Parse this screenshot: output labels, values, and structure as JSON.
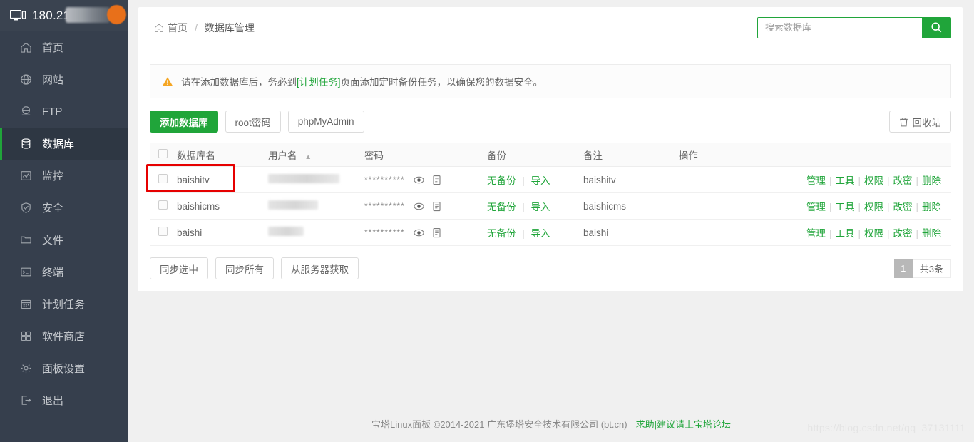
{
  "brand": {
    "ip": "180.215.",
    "icon": "monitor-icon"
  },
  "sidebar": {
    "items": [
      {
        "label": "首页",
        "icon": "home-icon",
        "active": false
      },
      {
        "label": "网站",
        "icon": "globe-icon",
        "active": false
      },
      {
        "label": "FTP",
        "icon": "ftp-icon",
        "active": false
      },
      {
        "label": "数据库",
        "icon": "database-icon",
        "active": true
      },
      {
        "label": "监控",
        "icon": "chart-icon",
        "active": false
      },
      {
        "label": "安全",
        "icon": "shield-icon",
        "active": false
      },
      {
        "label": "文件",
        "icon": "folder-icon",
        "active": false
      },
      {
        "label": "终端",
        "icon": "terminal-icon",
        "active": false
      },
      {
        "label": "计划任务",
        "icon": "calendar-icon",
        "active": false
      },
      {
        "label": "软件商店",
        "icon": "apps-icon",
        "active": false
      },
      {
        "label": "面板设置",
        "icon": "gear-icon",
        "active": false
      },
      {
        "label": "退出",
        "icon": "logout-icon",
        "active": false
      }
    ]
  },
  "breadcrumb": {
    "home": "首页",
    "separator": "/",
    "current": "数据库管理"
  },
  "search": {
    "placeholder": "搜索数据库",
    "value": "",
    "icon": "search-icon"
  },
  "alert": {
    "icon": "warning-icon",
    "before": "请在添加数据库后，务必到",
    "link": "[计划任务]",
    "after": "页面添加定时备份任务，以确保您的数据安全。"
  },
  "toolbar": {
    "add_db": "添加数据库",
    "root_password": "root密码",
    "phpmyadmin": "phpMyAdmin",
    "recycle_bin": "回收站",
    "recycle_icon": "trash-icon"
  },
  "table": {
    "columns": [
      "数据库名",
      "用户名",
      "密码",
      "备份",
      "备注",
      "操作"
    ],
    "sort_column": "用户名",
    "sort_direction": "asc",
    "password_mask": "**********",
    "eye_icon": "eye-icon",
    "copy_icon": "copy-icon",
    "backup_label": "无备份",
    "import_label": "导入",
    "ops": [
      "管理",
      "工具",
      "权限",
      "改密",
      "删除"
    ],
    "rows": [
      {
        "name": "baishitv",
        "username": "",
        "note": "baishitv",
        "highlighted": true
      },
      {
        "name": "baishicms",
        "username": "",
        "note": "baishicms",
        "highlighted": false
      },
      {
        "name": "baishi",
        "username": "",
        "note": "baishi",
        "highlighted": false
      }
    ]
  },
  "bottom": {
    "sync_selected": "同步选中",
    "sync_all": "同步所有",
    "fetch_from_server": "从服务器获取",
    "page_number": "1",
    "total": "共3条"
  },
  "footer": {
    "text": "宝塔Linux面板 ©2014-2021 广东堡塔安全技术有限公司 (bt.cn)",
    "link": "求助|建议请上宝塔论坛"
  },
  "watermark": "https://blog.csdn.net/qq_37131111",
  "colors": {
    "accent": "#20a53a",
    "sidebar": "#363f4d",
    "sidebar_active": "#2e3743",
    "highlight": "#e60000"
  }
}
